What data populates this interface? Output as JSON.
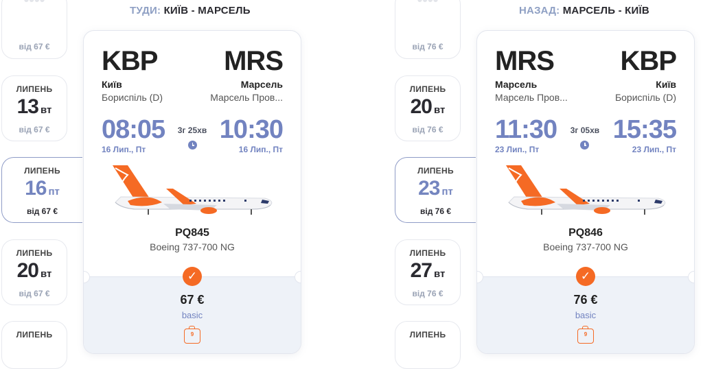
{
  "outbound": {
    "label": "ТУДИ:",
    "route": "КИЇВ - МАРСЕЛЬ",
    "dates": [
      {
        "price": "від 67 €"
      },
      {
        "month": "ЛИПЕНЬ",
        "day": "13",
        "weekday": "вт",
        "price": "від 67 €"
      },
      {
        "month": "ЛИПЕНЬ",
        "day": "16",
        "weekday": "пт",
        "price": "від 67 €",
        "selected": true
      },
      {
        "month": "ЛИПЕНЬ",
        "day": "20",
        "weekday": "вт",
        "price": "від 67 €"
      },
      {
        "month": "ЛИПЕНЬ"
      }
    ],
    "flight": {
      "from_code": "KBP",
      "to_code": "MRS",
      "from_city": "Київ",
      "to_city": "Марсель",
      "from_airport": "Бориспіль (D)",
      "to_airport": "Марсель Пров...",
      "dep_time": "08:05",
      "arr_time": "10:30",
      "duration": "3г 25хв",
      "dep_date": "16 Лип., Пт",
      "arr_date": "16 Лип., Пт",
      "flight_no": "PQ845",
      "aircraft": "Boeing 737-700 NG",
      "price": "67 €",
      "tariff": "basic",
      "baggage": "9"
    }
  },
  "return": {
    "label": "НАЗАД:",
    "route": "МАРСЕЛЬ - КИЇВ",
    "dates": [
      {
        "price": "від 76 €"
      },
      {
        "month": "ЛИПЕНЬ",
        "day": "20",
        "weekday": "вт",
        "price": "від 76 €"
      },
      {
        "month": "ЛИПЕНЬ",
        "day": "23",
        "weekday": "пт",
        "price": "від 76 €",
        "selected": true
      },
      {
        "month": "ЛИПЕНЬ",
        "day": "27",
        "weekday": "вт",
        "price": "від 76 €"
      },
      {
        "month": "ЛИПЕНЬ"
      }
    ],
    "flight": {
      "from_code": "MRS",
      "to_code": "KBP",
      "from_city": "Марсель",
      "to_city": "Київ",
      "from_airport": "Марсель Пров...",
      "to_airport": "Бориспіль (D)",
      "dep_time": "11:30",
      "arr_time": "15:35",
      "duration": "3г 05хв",
      "dep_date": "23 Лип., Пт",
      "arr_date": "23 Лип., Пт",
      "flight_no": "PQ846",
      "aircraft": "Boeing 737-700 NG",
      "price": "76 €",
      "tariff": "basic",
      "baggage": "9"
    }
  },
  "colors": {
    "accent": "#f56a24",
    "time_blue": "#7283c0",
    "fare_bg": "#eef2f8"
  },
  "icons": [
    "clock-icon",
    "check-icon",
    "baggage-icon",
    "airplane-image"
  ]
}
